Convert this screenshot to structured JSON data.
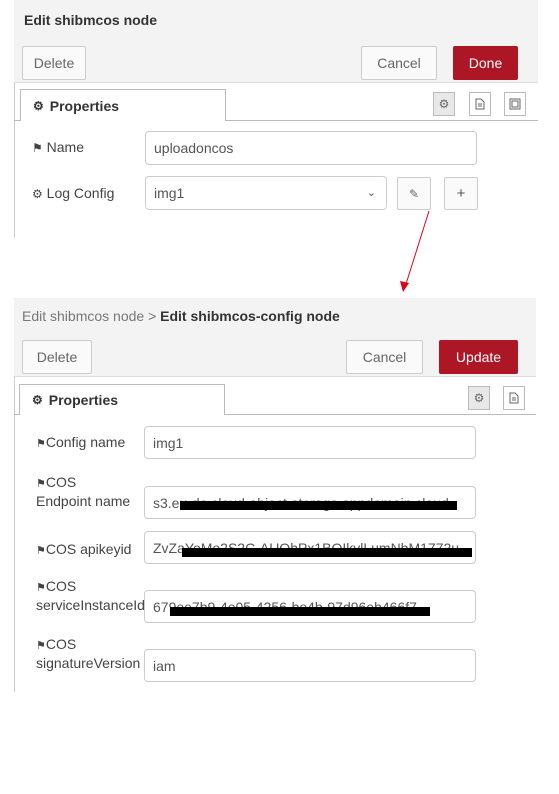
{
  "node_editor": {
    "title": "Edit shibmcos node",
    "delete_label": "Delete",
    "cancel_label": "Cancel",
    "done_label": "Done",
    "tab_label": "Properties",
    "fields": {
      "name_label": "Name",
      "name_value": "uploadoncos",
      "logconfig_label": "Log Config",
      "logconfig_value": "img1"
    },
    "icons": [
      "gear-icon",
      "document-icon",
      "frame-icon",
      "tag-icon",
      "cogs-icon",
      "chevron-down-icon",
      "pencil-icon",
      "plus-icon"
    ]
  },
  "config_editor": {
    "breadcrumb_parent": "Edit shibmcos node",
    "breadcrumb_separator": ">",
    "title": "Edit shibmcos-config node",
    "delete_label": "Delete",
    "cancel_label": "Cancel",
    "update_label": "Update",
    "tab_label": "Properties",
    "fields": [
      {
        "label_line1": "Config name",
        "label_line2": "",
        "value": "img1",
        "redacted": false
      },
      {
        "label_line1": "COS",
        "label_line2": "Endpoint name",
        "value": "s3.eu-de.cloud-object-storage.appdomain.cloud",
        "redacted": true
      },
      {
        "label_line1": "COS apikeyid",
        "label_line2": "",
        "value": "ZvZaYoMo2S2C-AUQhPx1BQIkvlLumNbM1772u",
        "redacted": true
      },
      {
        "label_line1": "COS",
        "label_line2": "serviceInstanceId",
        "value": "679ee7b9-4e05-4256-be4b-97d96eb466f7",
        "redacted": true
      },
      {
        "label_line1": "COS",
        "label_line2": "signatureVersion",
        "value": "iam",
        "redacted": false
      }
    ]
  },
  "colors": {
    "accent": "#ad1625",
    "arrow": "#e0001b"
  }
}
